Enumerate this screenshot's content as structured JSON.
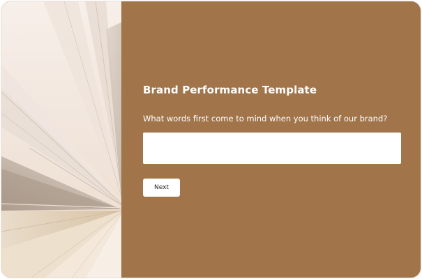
{
  "survey": {
    "title": "Brand Performance Template",
    "question": "What words first come to mind when you think of our brand?",
    "answer_value": "",
    "next_label": "Next"
  },
  "colors": {
    "panel_background": "#a1744a",
    "input_background": "#ffffff",
    "button_background": "#ffffff",
    "text_light": "#ffffff",
    "image_base": "#f5ece6"
  },
  "icons": {
    "decorative_image": "open-book-pages-image"
  }
}
